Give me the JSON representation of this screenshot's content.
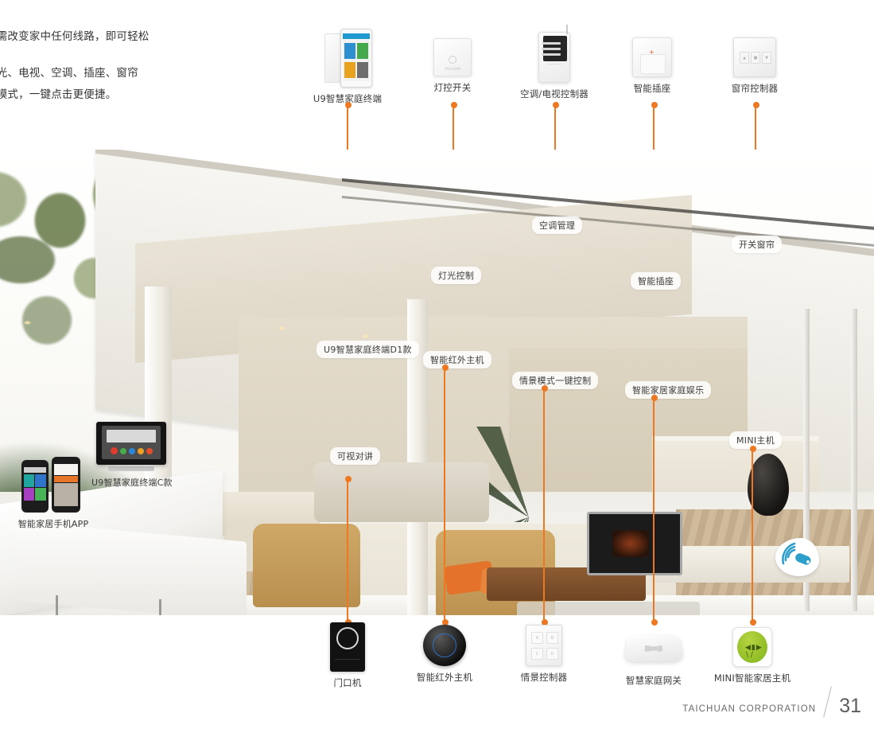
{
  "intro": {
    "line1": "无需改变家中任何线路，即可轻松",
    "line2": "灯光、电视、空调、插座、窗帘",
    "line3": "景模式，一键点击更便捷。"
  },
  "top_products": [
    {
      "name": "U9智慧家庭终端",
      "icon": "tablet-terminal-icon"
    },
    {
      "name": "灯控开关",
      "icon": "light-switch-icon"
    },
    {
      "name": "空调/电视控制器",
      "icon": "ac-tv-controller-icon"
    },
    {
      "name": "智能插座",
      "icon": "smart-socket-icon"
    },
    {
      "name": "窗帘控制器",
      "icon": "curtain-controller-icon"
    }
  ],
  "bottom_products": [
    {
      "name": "门口机",
      "icon": "door-station-icon"
    },
    {
      "name": "智能红外主机",
      "icon": "ir-host-icon"
    },
    {
      "name": "情景控制器",
      "icon": "scene-controller-icon"
    },
    {
      "name": "智慧家庭网关",
      "icon": "home-gateway-icon"
    },
    {
      "name": "MINI智能家居主机",
      "icon": "mini-smart-host-icon"
    }
  ],
  "callouts": [
    {
      "label": "空调管理"
    },
    {
      "label": "开关窗帘"
    },
    {
      "label": "灯光控制"
    },
    {
      "label": "智能插座"
    },
    {
      "label": "U9智慧家庭终端D1款"
    },
    {
      "label": "智能红外主机"
    },
    {
      "label": "情景模式一键控制"
    },
    {
      "label": "智能家居家庭娱乐"
    },
    {
      "label": "MINI主机"
    },
    {
      "label": "可视对讲"
    }
  ],
  "photo_labels": [
    {
      "label": "U9智慧家庭终端C款"
    },
    {
      "label": "智能家居手机APP"
    }
  ],
  "badge": {
    "icon": "wifi-remote-icon"
  },
  "footer": {
    "brand": "TAICHUAN CORPORATION",
    "page": "31"
  },
  "colors": {
    "accent": "#ee7821",
    "chip_text": "#3c3c3c",
    "footer_text": "#6a6a6a"
  }
}
